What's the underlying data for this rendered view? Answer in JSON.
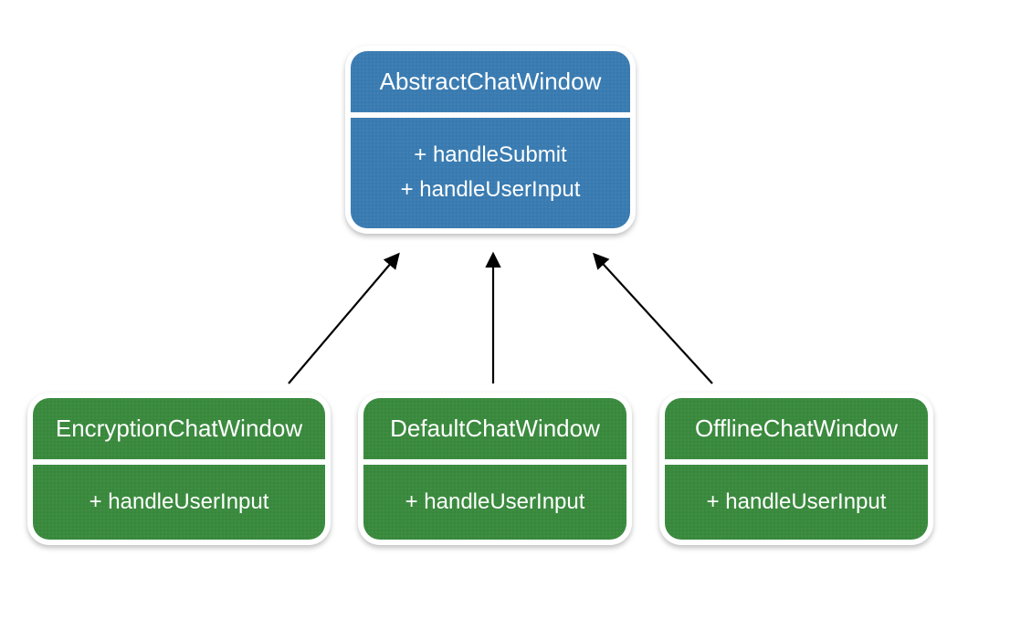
{
  "parent": {
    "title": "AbstractChatWindow",
    "methods": [
      "+ handleSubmit",
      "+ handleUserInput"
    ]
  },
  "children": [
    {
      "title": "EncryptionChatWindow",
      "methods": [
        "+ handleUserInput"
      ]
    },
    {
      "title": "DefaultChatWindow",
      "methods": [
        "+ handleUserInput"
      ]
    },
    {
      "title": "OfflineChatWindow",
      "methods": [
        "+ handleUserInput"
      ]
    }
  ],
  "colors": {
    "parent": "#3a7cb2",
    "child": "#3a8a3e"
  }
}
